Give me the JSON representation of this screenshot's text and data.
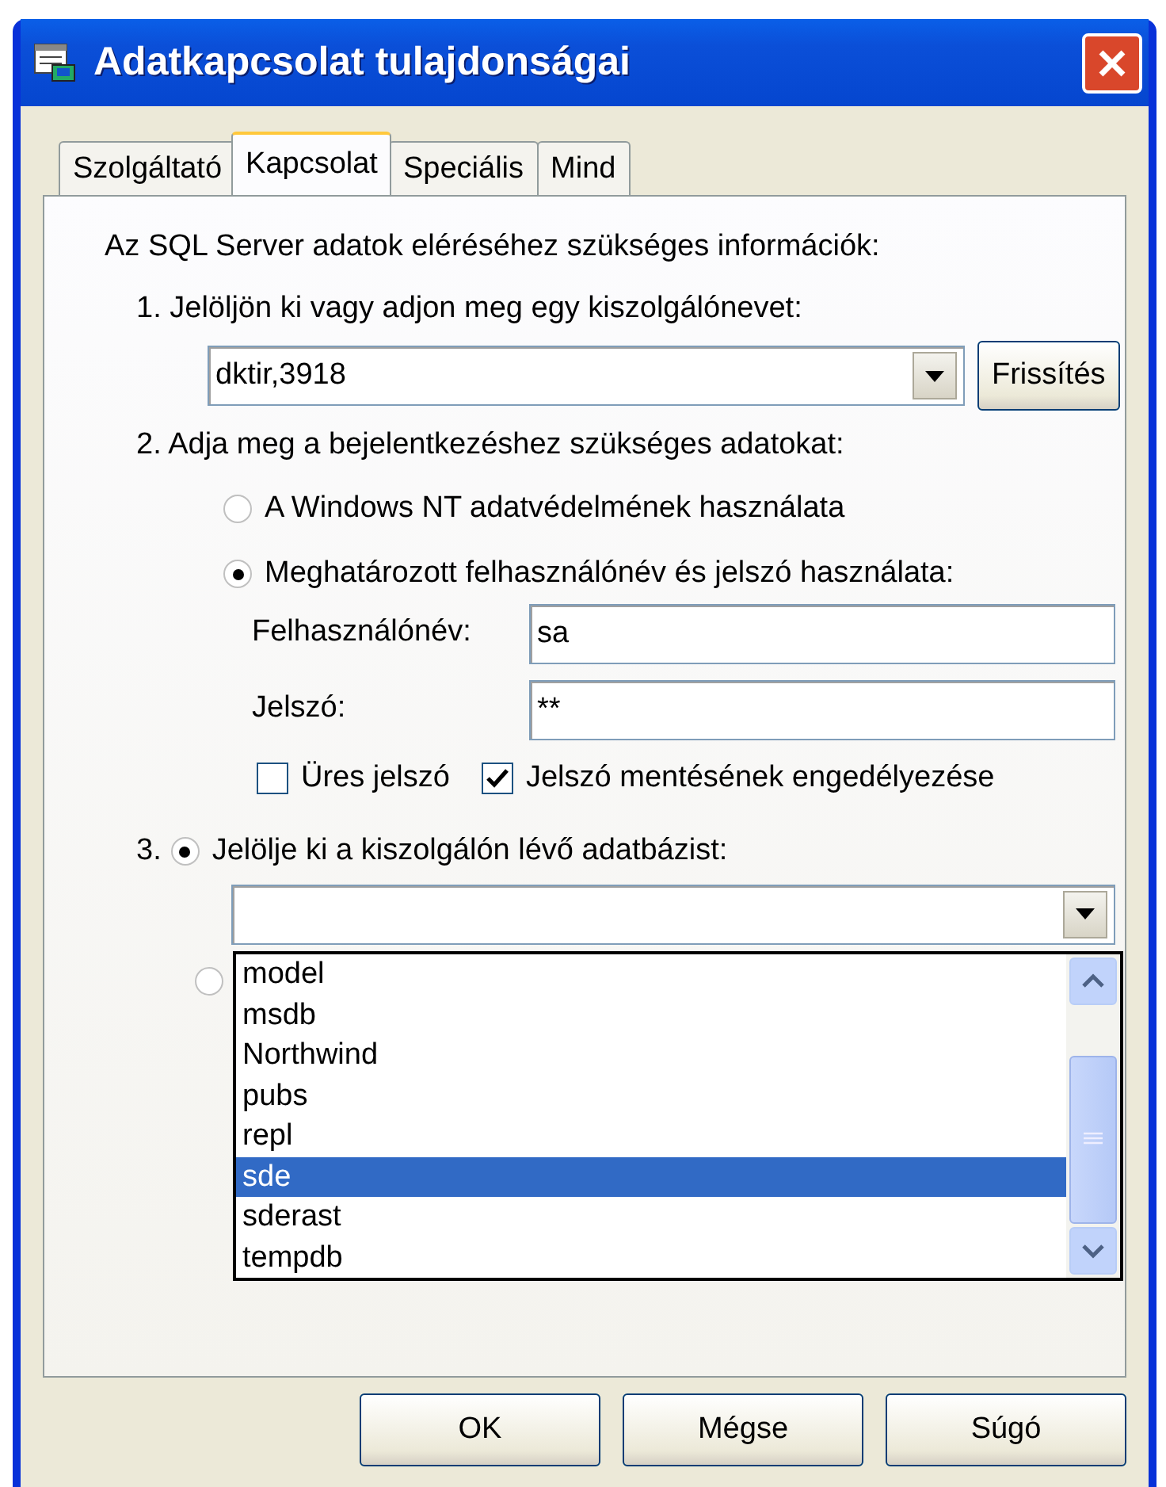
{
  "window": {
    "title": "Adatkapcsolat tulajdonságai"
  },
  "tabs": [
    {
      "label": "Szolgáltató",
      "selected": false
    },
    {
      "label": "Kapcsolat",
      "selected": true
    },
    {
      "label": "Speciális",
      "selected": false
    },
    {
      "label": "Mind",
      "selected": false
    }
  ],
  "intro": "Az SQL Server adatok eléréséhez szükséges információk:",
  "step1": {
    "label": "1. Jelöljön ki vagy adjon meg egy kiszolgálónevet:",
    "server": "dktir,3918",
    "refresh_button": "Frissítés"
  },
  "step2": {
    "label": "2. Adja meg a bejelentkezéshez szükséges adatokat:",
    "options": [
      {
        "label": "A Windows NT adatvédelmének használata",
        "selected": false
      },
      {
        "label": "Meghatározott felhasználónév és jelszó használata:",
        "selected": true
      }
    ],
    "username": {
      "label": "Felhasználónév:",
      "value": "sa"
    },
    "password": {
      "label": "Jelszó:",
      "value": "**"
    },
    "checkboxes": [
      {
        "label": "Üres jelszó",
        "checked": false
      },
      {
        "label": "Jelszó mentésének engedélyezése",
        "checked": true
      }
    ]
  },
  "step3": {
    "number": "3.",
    "options": [
      {
        "label": "Jelölje ki a kiszolgálón lévő adatbázist:",
        "selected": true
      },
      {
        "selected": false
      }
    ]
  },
  "database_list": [
    {
      "label": "model",
      "selected": false
    },
    {
      "label": "msdb",
      "selected": false
    },
    {
      "label": "Northwind",
      "selected": false
    },
    {
      "label": "pubs",
      "selected": false
    },
    {
      "label": "repl",
      "selected": false
    },
    {
      "label": "sde",
      "selected": true
    },
    {
      "label": "sderast",
      "selected": false
    },
    {
      "label": "tempdb",
      "selected": false
    }
  ],
  "buttons": [
    "OK",
    "Mégse",
    "Súgó"
  ]
}
